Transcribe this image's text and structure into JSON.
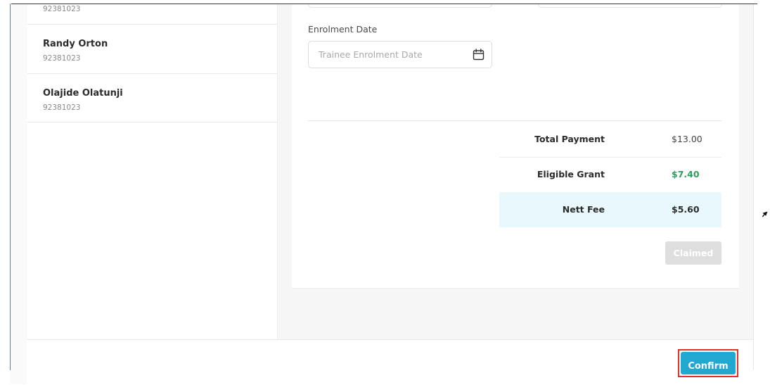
{
  "trainees": [
    {
      "name": "",
      "id": "92381023"
    },
    {
      "name": "Randy Orton",
      "id": "92381023"
    },
    {
      "name": "Olajide Olatunji",
      "id": "92381023"
    }
  ],
  "enrolment": {
    "label": "Enrolment Date",
    "placeholder": "Trainee Enrolment Date",
    "icon": "calendar-icon"
  },
  "summary": {
    "total_payment_label": "Total Payment",
    "total_payment_value": "$13.00",
    "eligible_grant_label": "Eligible Grant",
    "eligible_grant_value": "$7.40",
    "nett_fee_label": "Nett Fee",
    "nett_fee_value": "$5.60"
  },
  "buttons": {
    "claimed": "Claimed",
    "confirm": "Confirm"
  },
  "colors": {
    "accent": "#21a8d0",
    "grant_green": "#2e9e5a",
    "highlight_red": "#e0312a",
    "nett_row_bg": "#e8f8fd"
  }
}
